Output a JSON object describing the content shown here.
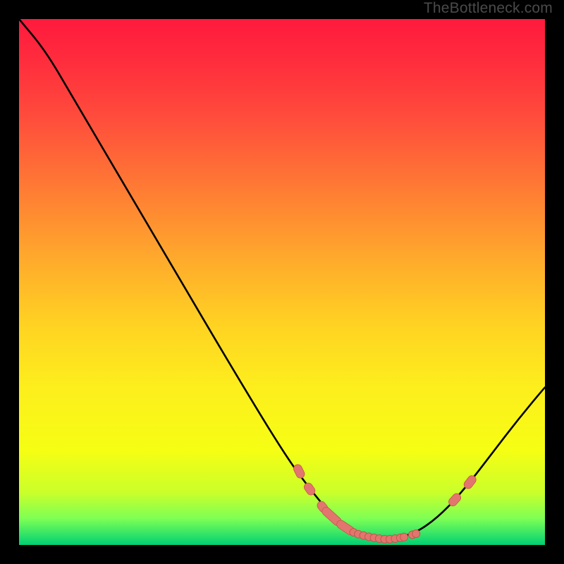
{
  "watermark": "TheBottleneck.com",
  "colors": {
    "background_frame": "#000000",
    "gradient_top": "#ff1a3d",
    "gradient_bottom": "#00d074",
    "curve_stroke": "#000000",
    "marker_fill": "#e2766e",
    "marker_stroke": "#c6544c"
  },
  "chart_data": {
    "type": "line",
    "title": "",
    "xlabel": "",
    "ylabel": "",
    "xlim": [
      0,
      100
    ],
    "ylim": [
      0,
      100
    ],
    "curve": [
      {
        "x": 0,
        "y": 100
      },
      {
        "x": 5,
        "y": 94
      },
      {
        "x": 10,
        "y": 85.5
      },
      {
        "x": 20,
        "y": 68.5
      },
      {
        "x": 30,
        "y": 51.5
      },
      {
        "x": 40,
        "y": 34.5
      },
      {
        "x": 50,
        "y": 18
      },
      {
        "x": 55,
        "y": 11
      },
      {
        "x": 60,
        "y": 5
      },
      {
        "x": 65,
        "y": 2
      },
      {
        "x": 70,
        "y": 1
      },
      {
        "x": 75,
        "y": 2
      },
      {
        "x": 80,
        "y": 5.5
      },
      {
        "x": 85,
        "y": 11
      },
      {
        "x": 90,
        "y": 17.5
      },
      {
        "x": 95,
        "y": 24
      },
      {
        "x": 100,
        "y": 30
      }
    ],
    "markers_left_branch": [
      {
        "x": 53,
        "y": 14.5
      },
      {
        "x": 53.5,
        "y": 13.5
      },
      {
        "x": 55,
        "y": 11
      },
      {
        "x": 55.5,
        "y": 10.3
      },
      {
        "x": 57.5,
        "y": 7.5
      },
      {
        "x": 57.9,
        "y": 7
      },
      {
        "x": 58.4,
        "y": 6.4
      },
      {
        "x": 60.5,
        "y": 4.5
      },
      {
        "x": 61.2,
        "y": 3.9
      },
      {
        "x": 63,
        "y": 2.7
      },
      {
        "x": 63.6,
        "y": 2.4
      }
    ],
    "markers_bottom_flat": [
      {
        "x": 64.5,
        "y": 2.05
      },
      {
        "x": 65.5,
        "y": 1.8
      },
      {
        "x": 66.5,
        "y": 1.55
      },
      {
        "x": 67.5,
        "y": 1.35
      },
      {
        "x": 68.5,
        "y": 1.2
      },
      {
        "x": 69.5,
        "y": 1.1
      },
      {
        "x": 70.5,
        "y": 1.1
      },
      {
        "x": 71.5,
        "y": 1.2
      },
      {
        "x": 72.5,
        "y": 1.35
      },
      {
        "x": 73.2,
        "y": 1.5
      },
      {
        "x": 74.8,
        "y": 1.95
      },
      {
        "x": 75.5,
        "y": 2.15
      }
    ],
    "markers_right_branch": [
      {
        "x": 82.5,
        "y": 8.2
      },
      {
        "x": 83.2,
        "y": 9
      },
      {
        "x": 85.4,
        "y": 11.5
      },
      {
        "x": 86.1,
        "y": 12.4
      }
    ]
  }
}
